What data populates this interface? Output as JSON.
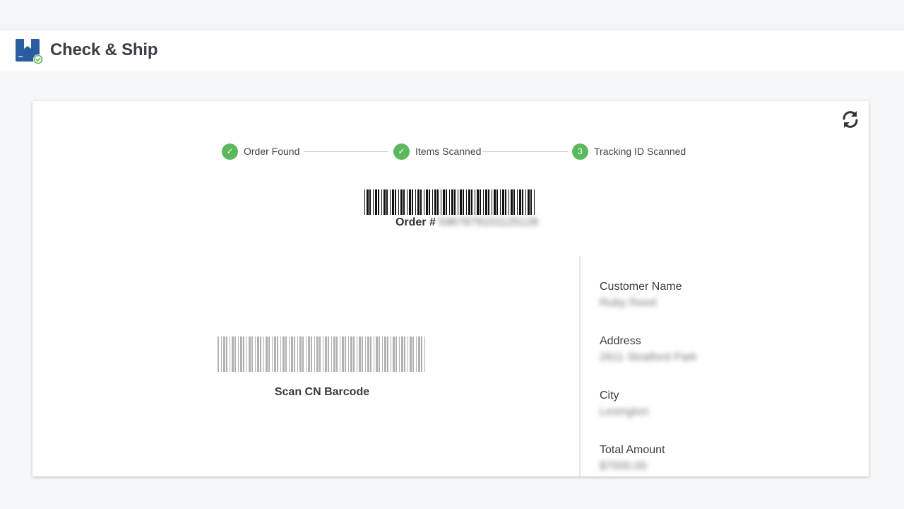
{
  "app": {
    "title": "Check & Ship",
    "logo_icon": "box-check-icon",
    "brand_color": "#2a5d9f",
    "check_color": "#5cb85c"
  },
  "toolbar": {
    "refresh_icon": "refresh-icon"
  },
  "steps": [
    {
      "label": "Order Found",
      "status": "done",
      "marker": "✓"
    },
    {
      "label": "Items Scanned",
      "status": "done",
      "marker": "✓"
    },
    {
      "label": "Tracking ID Scanned",
      "status": "current",
      "marker": "3"
    }
  ],
  "order": {
    "label": "Order #",
    "number": "5967879101125128"
  },
  "scan": {
    "label": "Scan CN Barcode"
  },
  "customer": {
    "name_label": "Customer Name",
    "name_value": "Ruby Reed",
    "address_label": "Address",
    "address_value": "2611 Stratford Park",
    "city_label": "City",
    "city_value": "Lexington",
    "amount_label": "Total Amount",
    "amount_value": "$7000.00"
  }
}
